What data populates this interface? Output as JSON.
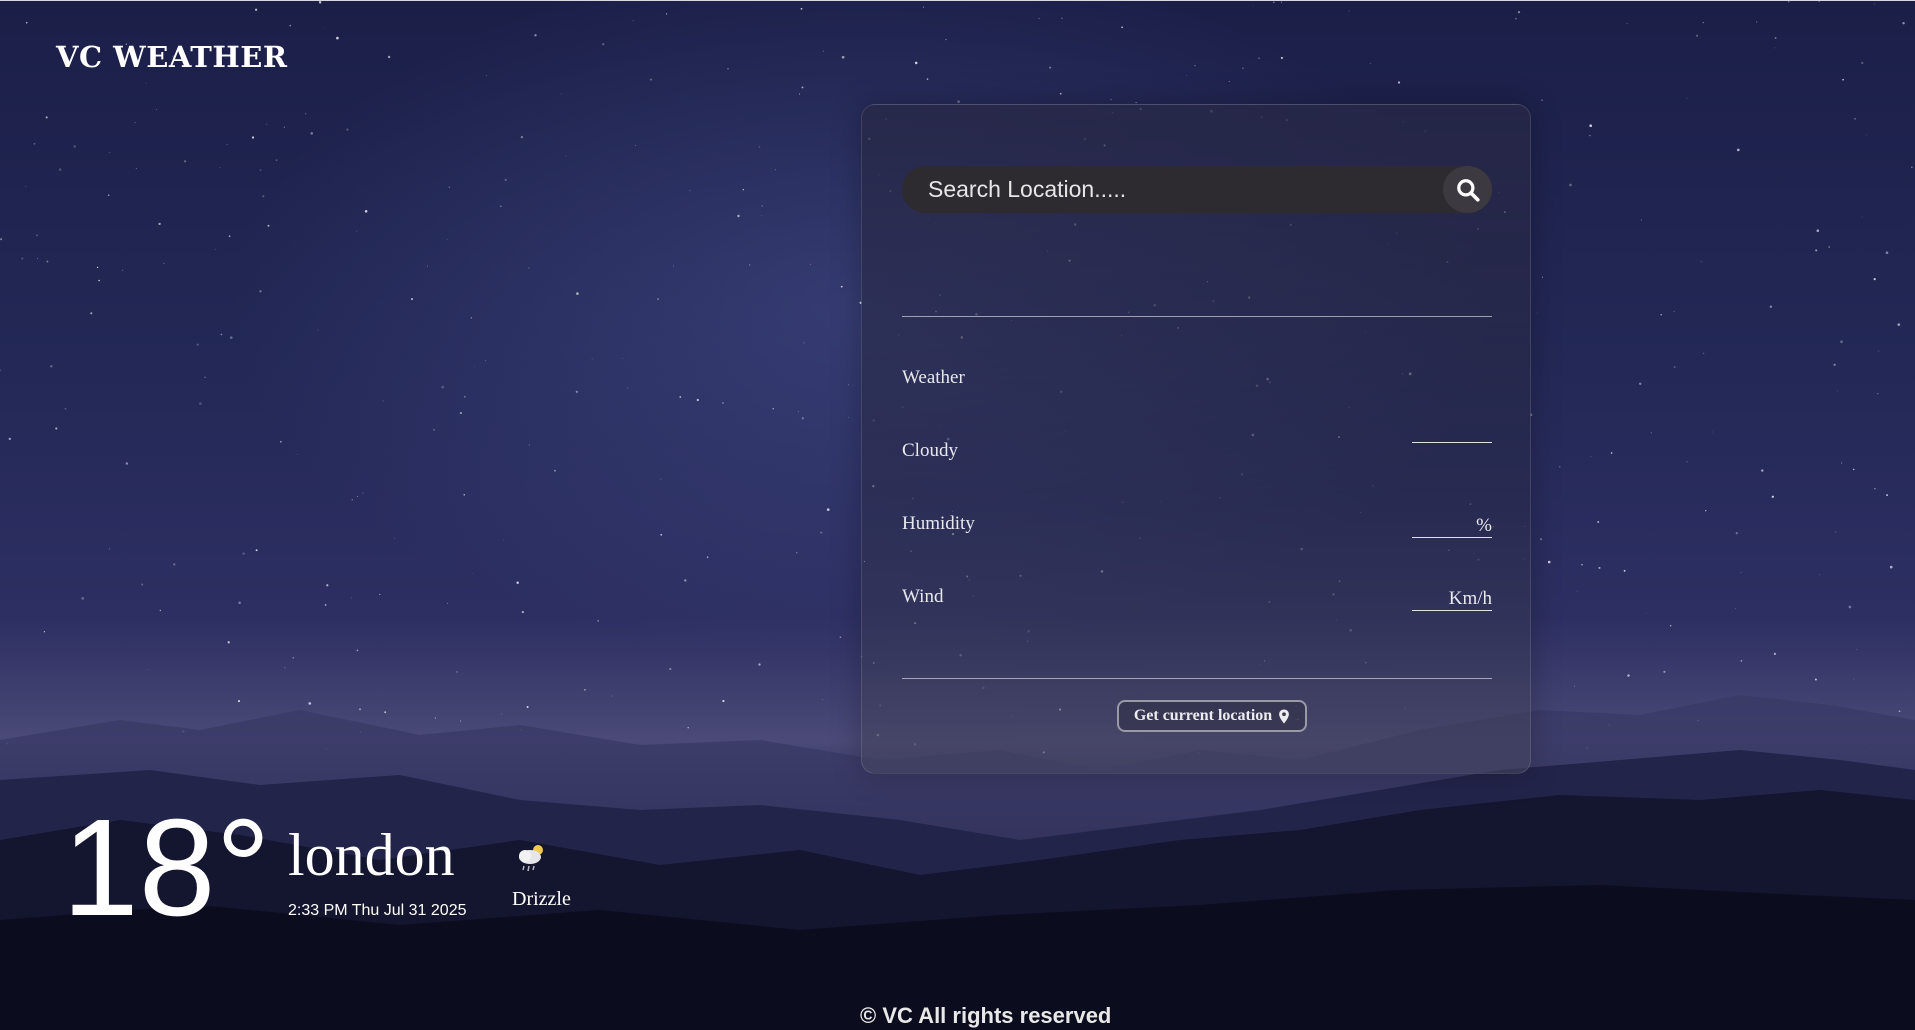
{
  "app": {
    "logo_text": "VC WEATHER"
  },
  "search": {
    "placeholder": "Search Location....."
  },
  "details": {
    "rows": [
      {
        "label": "Weather",
        "value": ""
      },
      {
        "label": "Cloudy",
        "value": ""
      },
      {
        "label": "Humidity",
        "value": "%"
      },
      {
        "label": "Wind",
        "value": "Km/h"
      }
    ],
    "location_button": "Get current location"
  },
  "current": {
    "temperature": "18°",
    "city": "london",
    "datetime": "2:33 PM Thu Jul 31 2025",
    "condition": "Drizzle",
    "condition_icon": "cloud-drizzle-icon"
  },
  "footer": {
    "text": "© VC All rights reserved"
  }
}
